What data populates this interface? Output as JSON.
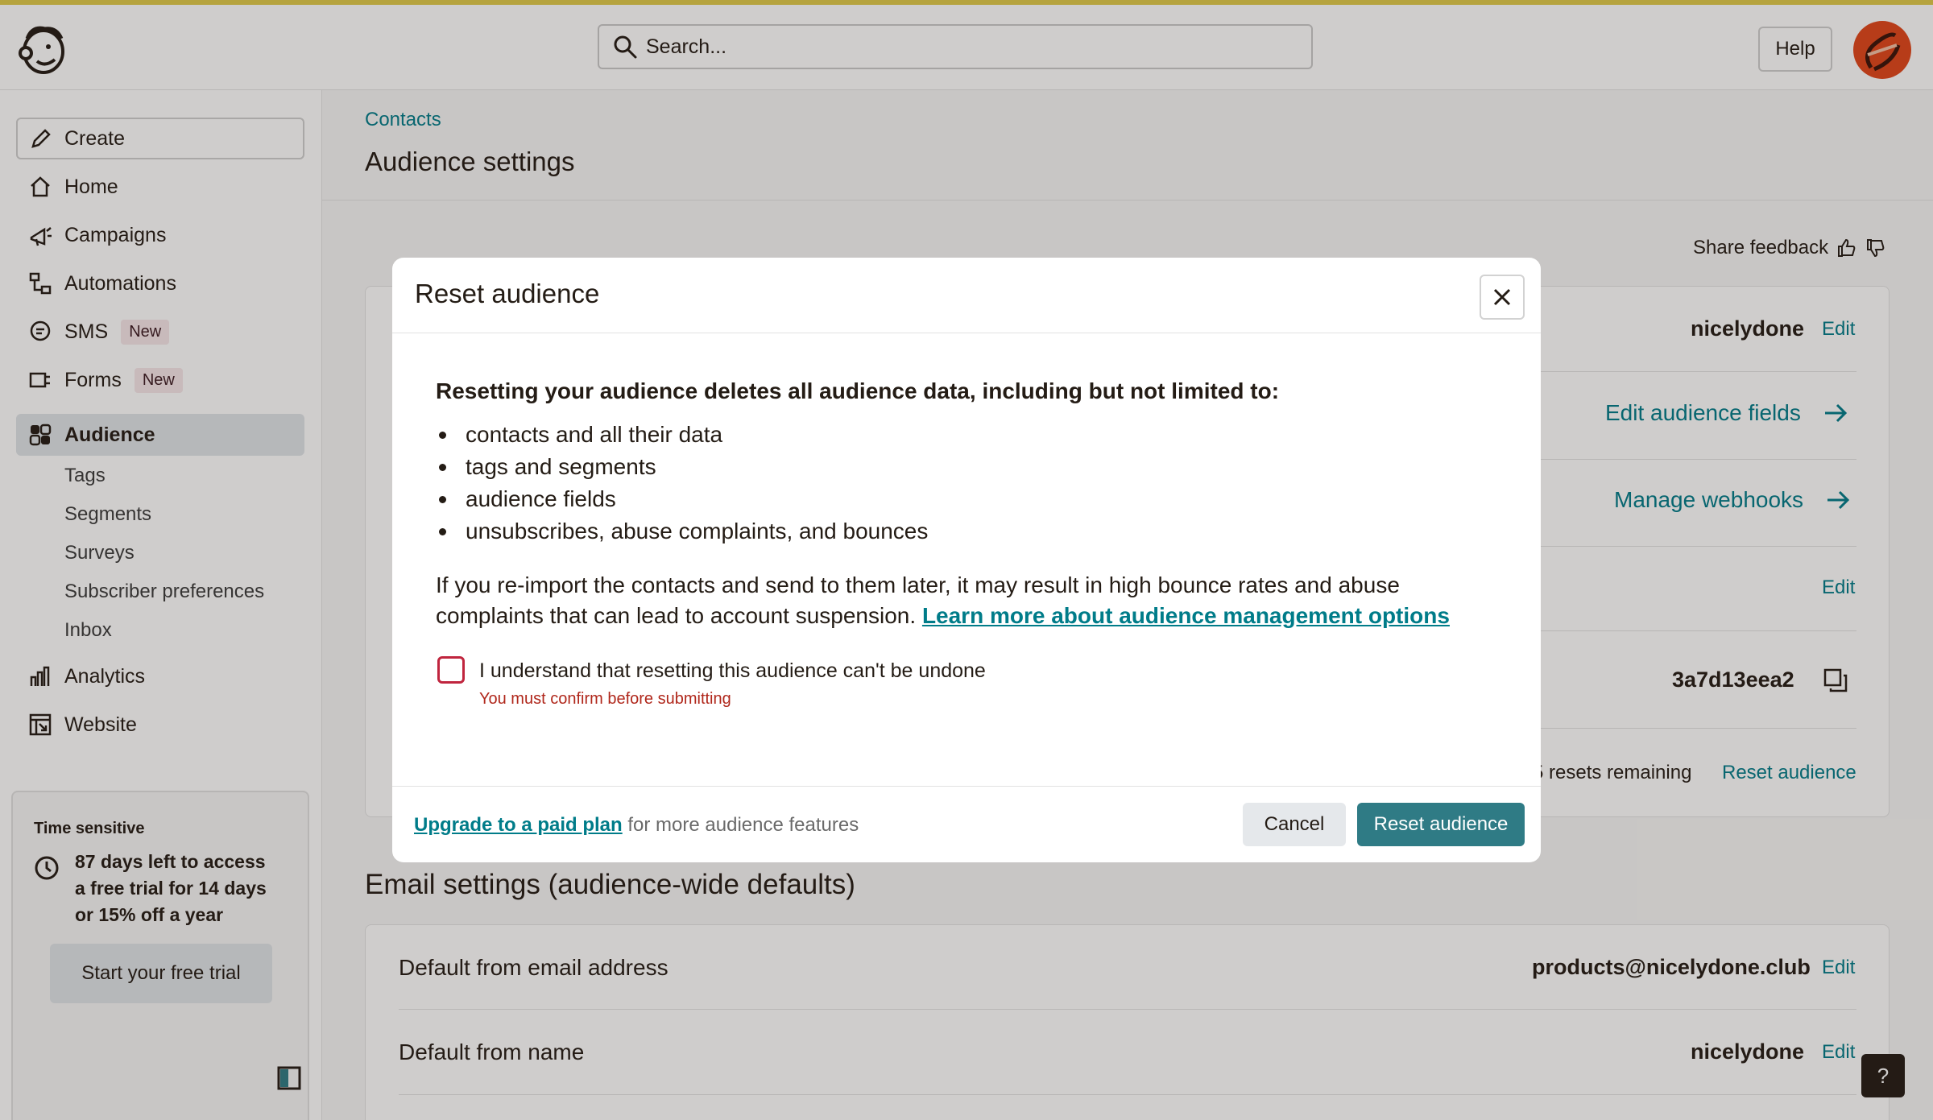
{
  "colors": {
    "accent": "#007c89",
    "primary_button": "#2f7b85",
    "error": "#c0253e",
    "top_strip": "#dfc94a"
  },
  "header": {
    "search_placeholder": "Search...",
    "help_label": "Help"
  },
  "sidebar": {
    "create_label": "Create",
    "items": [
      {
        "label": "Home",
        "icon": "home-icon"
      },
      {
        "label": "Campaigns",
        "icon": "megaphone-icon"
      },
      {
        "label": "Automations",
        "icon": "flow-icon"
      },
      {
        "label": "SMS",
        "badge": "New",
        "icon": "chat-icon"
      },
      {
        "label": "Forms",
        "badge": "New",
        "icon": "form-icon"
      },
      {
        "label": "Audience",
        "icon": "audience-icon",
        "active": true
      },
      {
        "label": "Analytics",
        "icon": "bar-chart-icon"
      },
      {
        "label": "Website",
        "icon": "website-icon"
      }
    ],
    "audience_subitems": [
      "Tags",
      "Segments",
      "Surveys",
      "Subscriber preferences",
      "Inbox"
    ],
    "trial": {
      "label": "Time sensitive",
      "text": "87 days left to access a free trial for 14 days or 15% off a year",
      "button": "Start your free trial"
    }
  },
  "main": {
    "breadcrumb": "Contacts",
    "title": "Audience settings",
    "feedback": "Share feedback",
    "audience_card": {
      "name_value": "nicelydone",
      "edit_label": "Edit",
      "edit_fields_link": "Edit audience fields",
      "webhooks_link": "Manage webhooks",
      "audience_id": "3a7d13eea2",
      "resets_remaining": "5 resets remaining",
      "reset_link": "Reset audience"
    },
    "email_settings": {
      "heading": "Email settings (audience-wide defaults)",
      "rows": [
        {
          "label": "Default from email address",
          "value": "products@nicelydone.club",
          "action": "Edit"
        },
        {
          "label": "Default from name",
          "value": "nicelydone",
          "action": "Edit"
        }
      ]
    },
    "help_fab": "?"
  },
  "modal": {
    "title": "Reset audience",
    "lead": "Resetting your audience deletes all audience data, including but not limited to:",
    "items": [
      "contacts and all their data",
      "tags and segments",
      "audience fields",
      "unsubscribes, abuse complaints, and bounces"
    ],
    "paragraph": "If you re-import the contacts and send to them later, it may result in high bounce rates and abuse complaints that can lead to account suspension.",
    "learn_more": "Learn more about audience management options",
    "checkbox_label": "I understand that resetting this audience can't be undone",
    "error": "You must confirm before submitting",
    "upgrade_link": "Upgrade to a paid plan",
    "upgrade_suffix": "for more audience features",
    "cancel": "Cancel",
    "confirm": "Reset audience"
  }
}
